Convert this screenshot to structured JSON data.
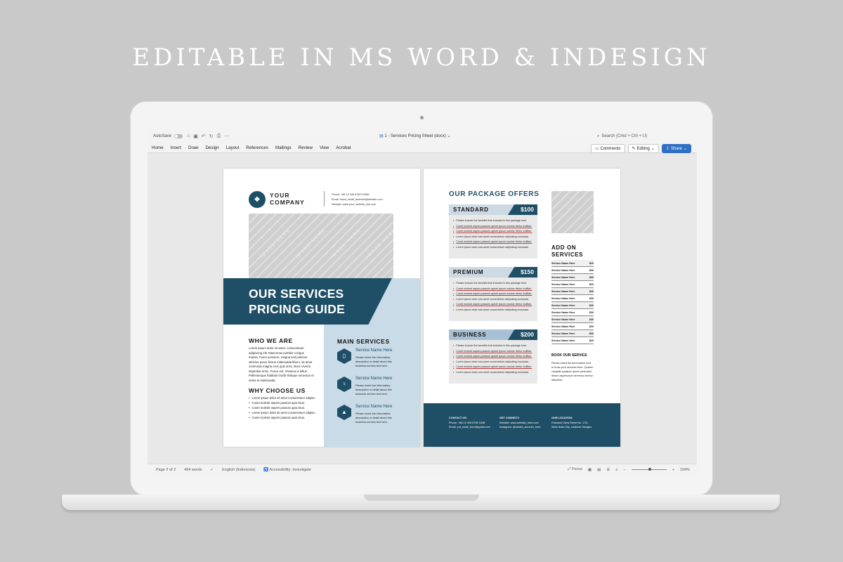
{
  "headline": "EDITABLE IN MS WORD & INDESIGN",
  "word": {
    "autosave_label": "AutoSave",
    "doc_title": "1 - Services Pricing Sheet (docx)",
    "search_placeholder": "Search (Cmd + Ctrl + U)",
    "menu": [
      "Home",
      "Insert",
      "Draw",
      "Design",
      "Layout",
      "References",
      "Mailings",
      "Review",
      "View",
      "Acrobat"
    ],
    "comments_label": "Comments",
    "editing_label": "Editing",
    "share_label": "Share",
    "status": {
      "page": "Page 2 of 2",
      "words": "464 words",
      "language": "English (Indonesia)",
      "accessibility": "Accessibility: Investigate",
      "focus": "Focus",
      "zoom": "104%"
    }
  },
  "page1": {
    "company": "YOUR COMPANY",
    "phone": "Phone: +88 12 345 6789 10088",
    "email": "Email: insert_email_address@website.com",
    "website": "Website: www.your_website_link.com",
    "image_placeholder": "IMAGE HERE",
    "title_line1": "OUR SERVICES",
    "title_line2": "PRICING GUIDE",
    "who_heading": "WHO WE ARE",
    "who_text": "Lorem ipsum dolor sit amet, consectetuer adipiscing elit. Maecenas porttitor congue massa. Fusce posuere, magna sed pulvinar ultricies purus lectus malesuada libero, sit amet commodo magna eros quis urna. Nunc viverra imperdiet enim. Fusce est. Vivamus a tellus. Pellentesque habitant morbi tristique senectus et netus et malesuada.",
    "why_heading": "WHY CHOOSE US",
    "why_items": [
      "Lorem ipsum dolor sit amet consectetuer adipisc.",
      "Conet molestr aspers passoin apia risus.",
      "Conet molestr aspers passoin apia risus.",
      "Lorem ipsum dolor sit amet consectetuer adipisc.",
      "Conet molestr aspers passoin apia risus."
    ],
    "main_services_heading": "MAIN SERVICES",
    "services": [
      {
        "name": "Service Name Here",
        "desc": "Please insert the information, description or detail about this business service text here."
      },
      {
        "name": "Service Name Here",
        "desc": "Please insert the information, description or detail about this business service text here."
      },
      {
        "name": "Service Name Here",
        "desc": "Please insert the information, description or detail about this business service text here."
      }
    ]
  },
  "page2": {
    "offers_heading": "OUR PACKAGE OFFERS",
    "packages": [
      {
        "name": "STANDARD",
        "price": "$100"
      },
      {
        "name": "PREMIUM",
        "price": "$150"
      },
      {
        "name": "BUSINESS",
        "price": "$200"
      }
    ],
    "package_items": [
      "Please include the benefits that included in this package here.",
      "Conet molestr aspers passoin apiset ipsum nosime rfertor inditlan.",
      "Conet molestr aspers passoin apiset ipsum nosime rfertor inditlan.",
      "Lorem ipsum dolor sea amet consectetuer adipisking ecculsala.",
      "Conet molestr aspers passoin apiset ipsum nosime rfertor inditlan.",
      "Lorem ipsum dolor sea amet consectetuer adipisking ecculsala."
    ],
    "addon_heading_1": "ADD ON",
    "addon_heading_2": "SERVICES",
    "addons": [
      {
        "name": "Service Name Here",
        "price": "$20"
      },
      {
        "name": "Service Name Here",
        "price": "$30"
      },
      {
        "name": "Service Name Here",
        "price": "$30"
      },
      {
        "name": "Service Name Here",
        "price": "$20"
      },
      {
        "name": "Service Name Here",
        "price": "$30"
      },
      {
        "name": "Service Name Here",
        "price": "$30"
      },
      {
        "name": "Service Name Here",
        "price": "$20"
      },
      {
        "name": "Service Name Here",
        "price": "$30"
      },
      {
        "name": "Service Name Here",
        "price": "$30"
      },
      {
        "name": "Service Name Here",
        "price": "$20"
      },
      {
        "name": "Service Name Here",
        "price": "$30"
      },
      {
        "name": "Service Name Here",
        "price": "$20"
      }
    ],
    "book_heading": "BOOK OUR SERVICE",
    "book_text": "Please insert the information how to book your services here. Quaser voluptat quaisper ipsum pesmeter, letrom aspersonat nemenzo temtor laborlese.",
    "footer": {
      "contact_heading": "CONTACT US:",
      "contact_phone": "Phone: +88 12 345 6789 1008",
      "contact_email": "Email: put_email_here@gmail.com",
      "connect_heading": "GET CONNECT:",
      "connect_web": "Website: www.website_here.com",
      "connect_ig": "Instagram: @media_account_here",
      "location_heading": "OUR LOCATION:",
      "location_line1": "Praesent Viera Street No. 17D,",
      "location_line2": "West Nulla City, LeaNore Designs"
    }
  },
  "colors": {
    "navy": "#1f4f66",
    "light_blue": "#c9dbe7",
    "share_blue": "#2f6fc4"
  }
}
